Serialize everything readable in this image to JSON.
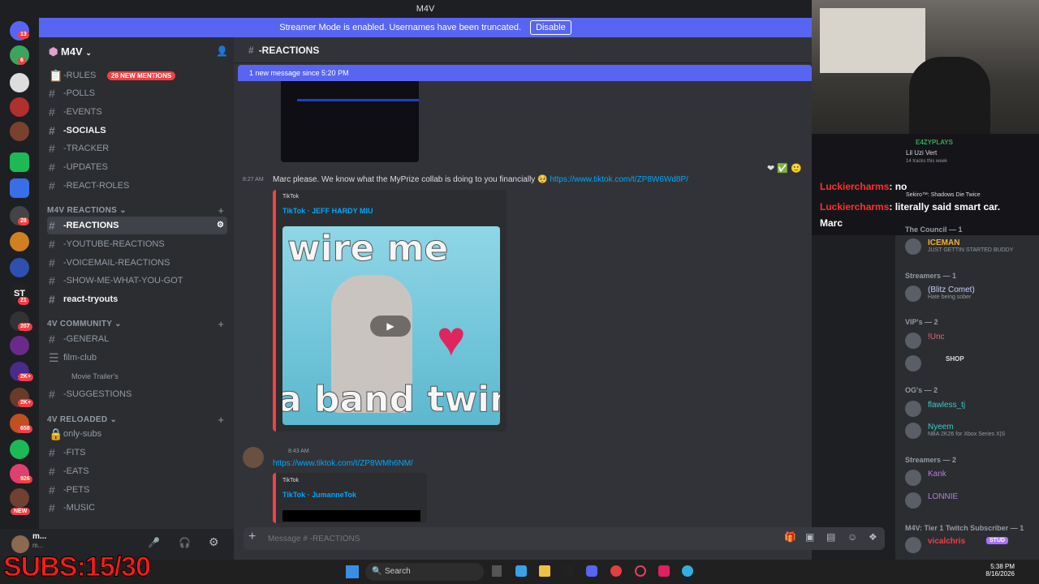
{
  "window": {
    "title": "M4V"
  },
  "notice": {
    "text": "Streamer Mode is enabled. Usernames have been truncated.",
    "button": "Disable"
  },
  "rail": {
    "badges": [
      "13",
      "6",
      "1",
      "1",
      "1",
      "28",
      "2",
      "21",
      "207",
      "2K+",
      "2K+",
      "658",
      "1",
      "926",
      "1"
    ],
    "new_label": "NEW"
  },
  "server": {
    "name": "M4V"
  },
  "mentions": "28 NEW MENTIONS",
  "channels_top": [
    "-RULES",
    "-POLLS",
    "-EVENTS",
    "-SOCIALS",
    "-TRACKER",
    "-UPDATES",
    "-REACT-ROLES"
  ],
  "cat1": {
    "name": "M4V REACTIONS",
    "channels": [
      "-REACTIONS",
      "-YOUTUBE-REACTIONS",
      "-VOICEMAIL-REACTIONS",
      "-SHOW-ME-WHAT-YOU-GOT",
      "react-tryouts"
    ]
  },
  "cat2": {
    "name": "4V COMMUNITY",
    "channels": [
      "-GENERAL",
      "film-club",
      "Movie Trailer's",
      "-SUGGESTIONS"
    ]
  },
  "cat3": {
    "name": "4V RELOADED",
    "channels": [
      "only-subs",
      "-FITS",
      "-EATS",
      "-PETS",
      "-MUSIC"
    ]
  },
  "user": {
    "name": "m...",
    "status": "m..."
  },
  "header": {
    "channel": "-REACTIONS"
  },
  "new_message_bar": "1 new message since 5:20 PM",
  "msg1": {
    "time": "8:27 AM",
    "text": "Marc please. We know what the MyPrize collab is doing to you financially",
    "link": "https://www.tiktok.com/t/ZP8W6Wd8P/",
    "embed_provider": "TikTok",
    "embed_title": "TikTok · JEFF HARDY MIU",
    "thumb_top": "wire me",
    "thumb_bottom": "a band twin"
  },
  "msg2": {
    "time": "8:43 AM",
    "link": "https://www.tiktok.com/t/ZP8WMh6NM/",
    "embed_provider": "TikTok",
    "embed_title": "TikTok · JumanneTok"
  },
  "composer": {
    "placeholder": "Message # -REACTIONS"
  },
  "twitch": {
    "streamer": "E4ZYPLAYS",
    "song": "Lil Uzi Vert",
    "tracks": "14 tracks this week",
    "game": "Sekiro™: Shadows Die Twice",
    "chat": [
      {
        "user": "Luckiercharms",
        "text": ": no"
      },
      {
        "user": "Luckiercharms",
        "text": ": literally said smart car."
      },
      {
        "user": "Marc",
        "text": ""
      }
    ]
  },
  "members": [
    {
      "header": "The Council — 1",
      "users": [
        {
          "name": "ICEMAN",
          "status": "JUST GETTIN STARTED BUDDY",
          "color": "#f0b232"
        }
      ]
    },
    {
      "header": "Streamers — 1",
      "users": [
        {
          "name": "(Blitz Comet)",
          "status": "Hate being sober",
          "color": "#c9cdfb"
        }
      ]
    },
    {
      "header": "VIP's — 2",
      "users": [
        {
          "name": "!Unc",
          "status": "",
          "color": "#e06c75"
        },
        {
          "name": "SHOP",
          "status": "",
          "color": "#dbdee1"
        }
      ]
    },
    {
      "header": "OG's — 2",
      "users": [
        {
          "name": "flawless_tj",
          "status": "",
          "color": "#3ec9c9"
        },
        {
          "name": "Nyeem",
          "status": "NBA 2K26 for Xbox Series X|S",
          "color": "#3ec9c9"
        }
      ]
    },
    {
      "header": "Streamers — 2",
      "users": [
        {
          "name": "Kank",
          "status": "",
          "color": "#b57edc"
        },
        {
          "name": "LONNIE",
          "status": "",
          "color": "#b57edc"
        }
      ]
    },
    {
      "header": "M4V: Tier 1 Twitch Subscriber — 1",
      "users": [
        {
          "name": "vicalchris",
          "status": "",
          "color": "#f23f43"
        }
      ]
    }
  ],
  "stud": "STUD",
  "taskbar": {
    "search": "Search",
    "time": "5:38 PM",
    "date": "8/16/2026"
  },
  "overlay": {
    "subs": "SUBS:15/30"
  }
}
